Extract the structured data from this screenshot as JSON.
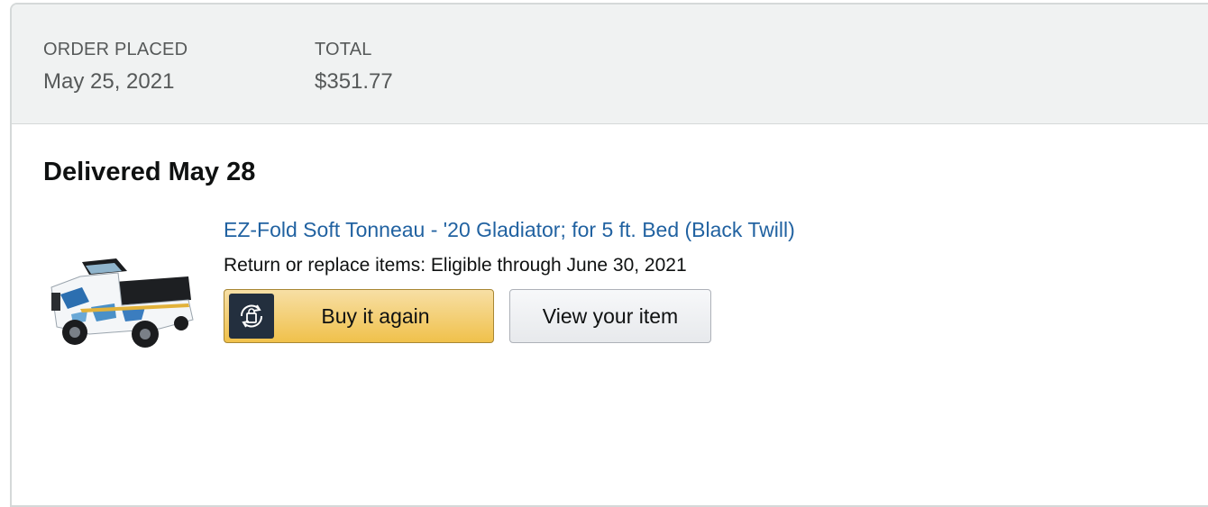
{
  "order_header": {
    "placed_label": "ORDER PLACED",
    "placed_value": "May 25, 2021",
    "total_label": "TOTAL",
    "total_value": "$351.77"
  },
  "shipment": {
    "status": "Delivered May 28",
    "item": {
      "title": "EZ-Fold Soft Tonneau - '20 Gladiator; for 5 ft. Bed (Black Twill)",
      "return_text": "Return or replace items: Eligible through June 30, 2021",
      "image": "product-truck-image"
    }
  },
  "actions": {
    "buy_again_label": "Buy it again",
    "buy_again_icon": "buy-again-icon",
    "view_item_label": "View your item"
  },
  "colors": {
    "link": "#2162a1",
    "header_bg": "#f0f2f2",
    "buy_button": "#f0c14b",
    "icon_box": "#232f3e"
  }
}
